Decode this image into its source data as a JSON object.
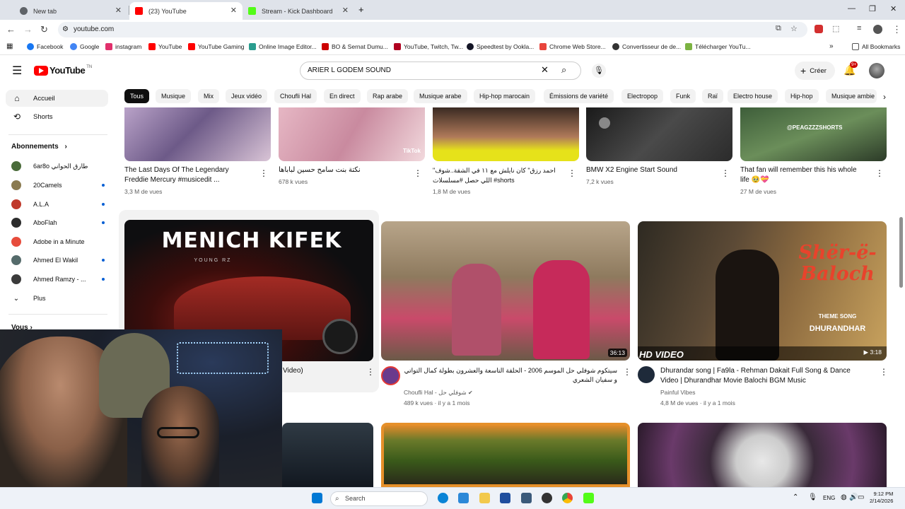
{
  "browser": {
    "tabs": [
      {
        "title": "New tab",
        "favicon_color": "#5f6368"
      },
      {
        "title": "(23) YouTube",
        "favicon_color": "#ff0000"
      },
      {
        "title": "Stream - Kick Dashboard",
        "favicon_color": "#53fc18"
      }
    ],
    "new_tab_glyph": "+",
    "url": "youtube.com",
    "bookmarks": [
      {
        "label": "Facebook",
        "color": "#1877f2"
      },
      {
        "label": "Google",
        "color": "#4285f4"
      },
      {
        "label": "instagram",
        "color": "#e1306c"
      },
      {
        "label": "YouTube",
        "color": "#ff0000"
      },
      {
        "label": "YouTube Gaming",
        "color": "#ff0000"
      },
      {
        "label": "Online Image Editor...",
        "color": "#2a9d8f"
      },
      {
        "label": "BO & Sernat Dumu...",
        "color": "#cc0000"
      },
      {
        "label": "YouTube, Twitch, Tw...",
        "color": "#b00020"
      },
      {
        "label": "Speedtest by Ookla...",
        "color": "#141526"
      },
      {
        "label": "Chrome Web Store...",
        "color": "#e8453c"
      },
      {
        "label": "Convertisseur de de...",
        "color": "#333333"
      },
      {
        "label": "Télécharger YouTu...",
        "color": "#7cb342"
      }
    ],
    "all_bookmarks": "All Bookmarks"
  },
  "youtube": {
    "logo_text": "YouTube",
    "logo_suffix": "TN",
    "search_value": "ARIER L GODEM SOUND",
    "create_label": "Créer",
    "notifications_badge": "9+",
    "chips": [
      "Tous",
      "Musique",
      "Mix",
      "Jeux vidéo",
      "Choufli Hal",
      "En direct",
      "Rap arabe",
      "Musique arabe",
      "Hip-hop marocain",
      "Émissions de variété",
      "Electropop",
      "Funk",
      "Raï",
      "Electro house",
      "Hip-hop",
      "Musique ambie"
    ],
    "sidebar": {
      "home": "Accueil",
      "shorts": "Shorts",
      "subscriptions_title": "Abonnements",
      "subscriptions": [
        {
          "name": "6ar8o طارق الحواني",
          "color": "#4a6b3a"
        },
        {
          "name": "20Camels",
          "color": "#8a7a50"
        },
        {
          "name": "A.L.A",
          "color": "#c0392b"
        },
        {
          "name": "AboFlah",
          "color": "#2c2c2c"
        },
        {
          "name": "Adobe in a Minute",
          "color": "#e74c3c"
        },
        {
          "name": "Ahmed El Wakil",
          "color": "#556b6b"
        },
        {
          "name": "Ahmed Ramzy - ...",
          "color": "#3b3b3b"
        }
      ],
      "more": "Plus",
      "you": "Vous"
    },
    "shorts_row": [
      {
        "title": "The Last Days Of The Legendary Freddie Mercury #musicedit ...",
        "views": "3,3 M de vues"
      },
      {
        "title": "نكتة بنت سامح حسين لباباها",
        "views": "678 k vues",
        "overlay": "TikTok"
      },
      {
        "title": "\"احمد رزق\" كان نايلش مع ١١ في الشقة..شوف اللي حصل #مسلسلات #shorts",
        "views": "1,8 M de vues"
      },
      {
        "title": "BMW X2 Engine Start Sound",
        "views": "7,2 k vues"
      },
      {
        "title": "That fan will remember this his whole life 🥹💝",
        "views": "27 M de vues",
        "overlay": "@PEAGZZZSHORTS"
      }
    ],
    "videos": [
      {
        "title": "Video)",
        "thumb_text": "MENICH KIFEK",
        "thumb_sub": "YOUNG RZ"
      },
      {
        "title": "سيتكوم شوفلي حل الموسم 2006 - الحلقة التاسعة والعشرون بطولة كمال التواتي و سفيان الشعري",
        "channel": "Choufli Hal - شوفلي حل",
        "stats": "489 k vues · il y a 1 mois",
        "duration": "36:13"
      },
      {
        "title": "Dhurandar song | Fa9la - Rehman Dakait Full Song & Dance Video | Dhurandhar Movie Balochi BGM Music",
        "channel": "Painful Vibes",
        "stats": "4,8 M de vues · il y a 1 mois",
        "duration": "3:18",
        "thumb_text": "Shër-ë-Baloch",
        "thumb_sub": "THEME SONG",
        "thumb_sub2": "DHURANDHAR",
        "hd_label": "HD VIDEO"
      }
    ]
  },
  "taskbar": {
    "search": "Search",
    "lang": "ENG",
    "time": "9:12 PM",
    "date": "2/14/2026"
  }
}
